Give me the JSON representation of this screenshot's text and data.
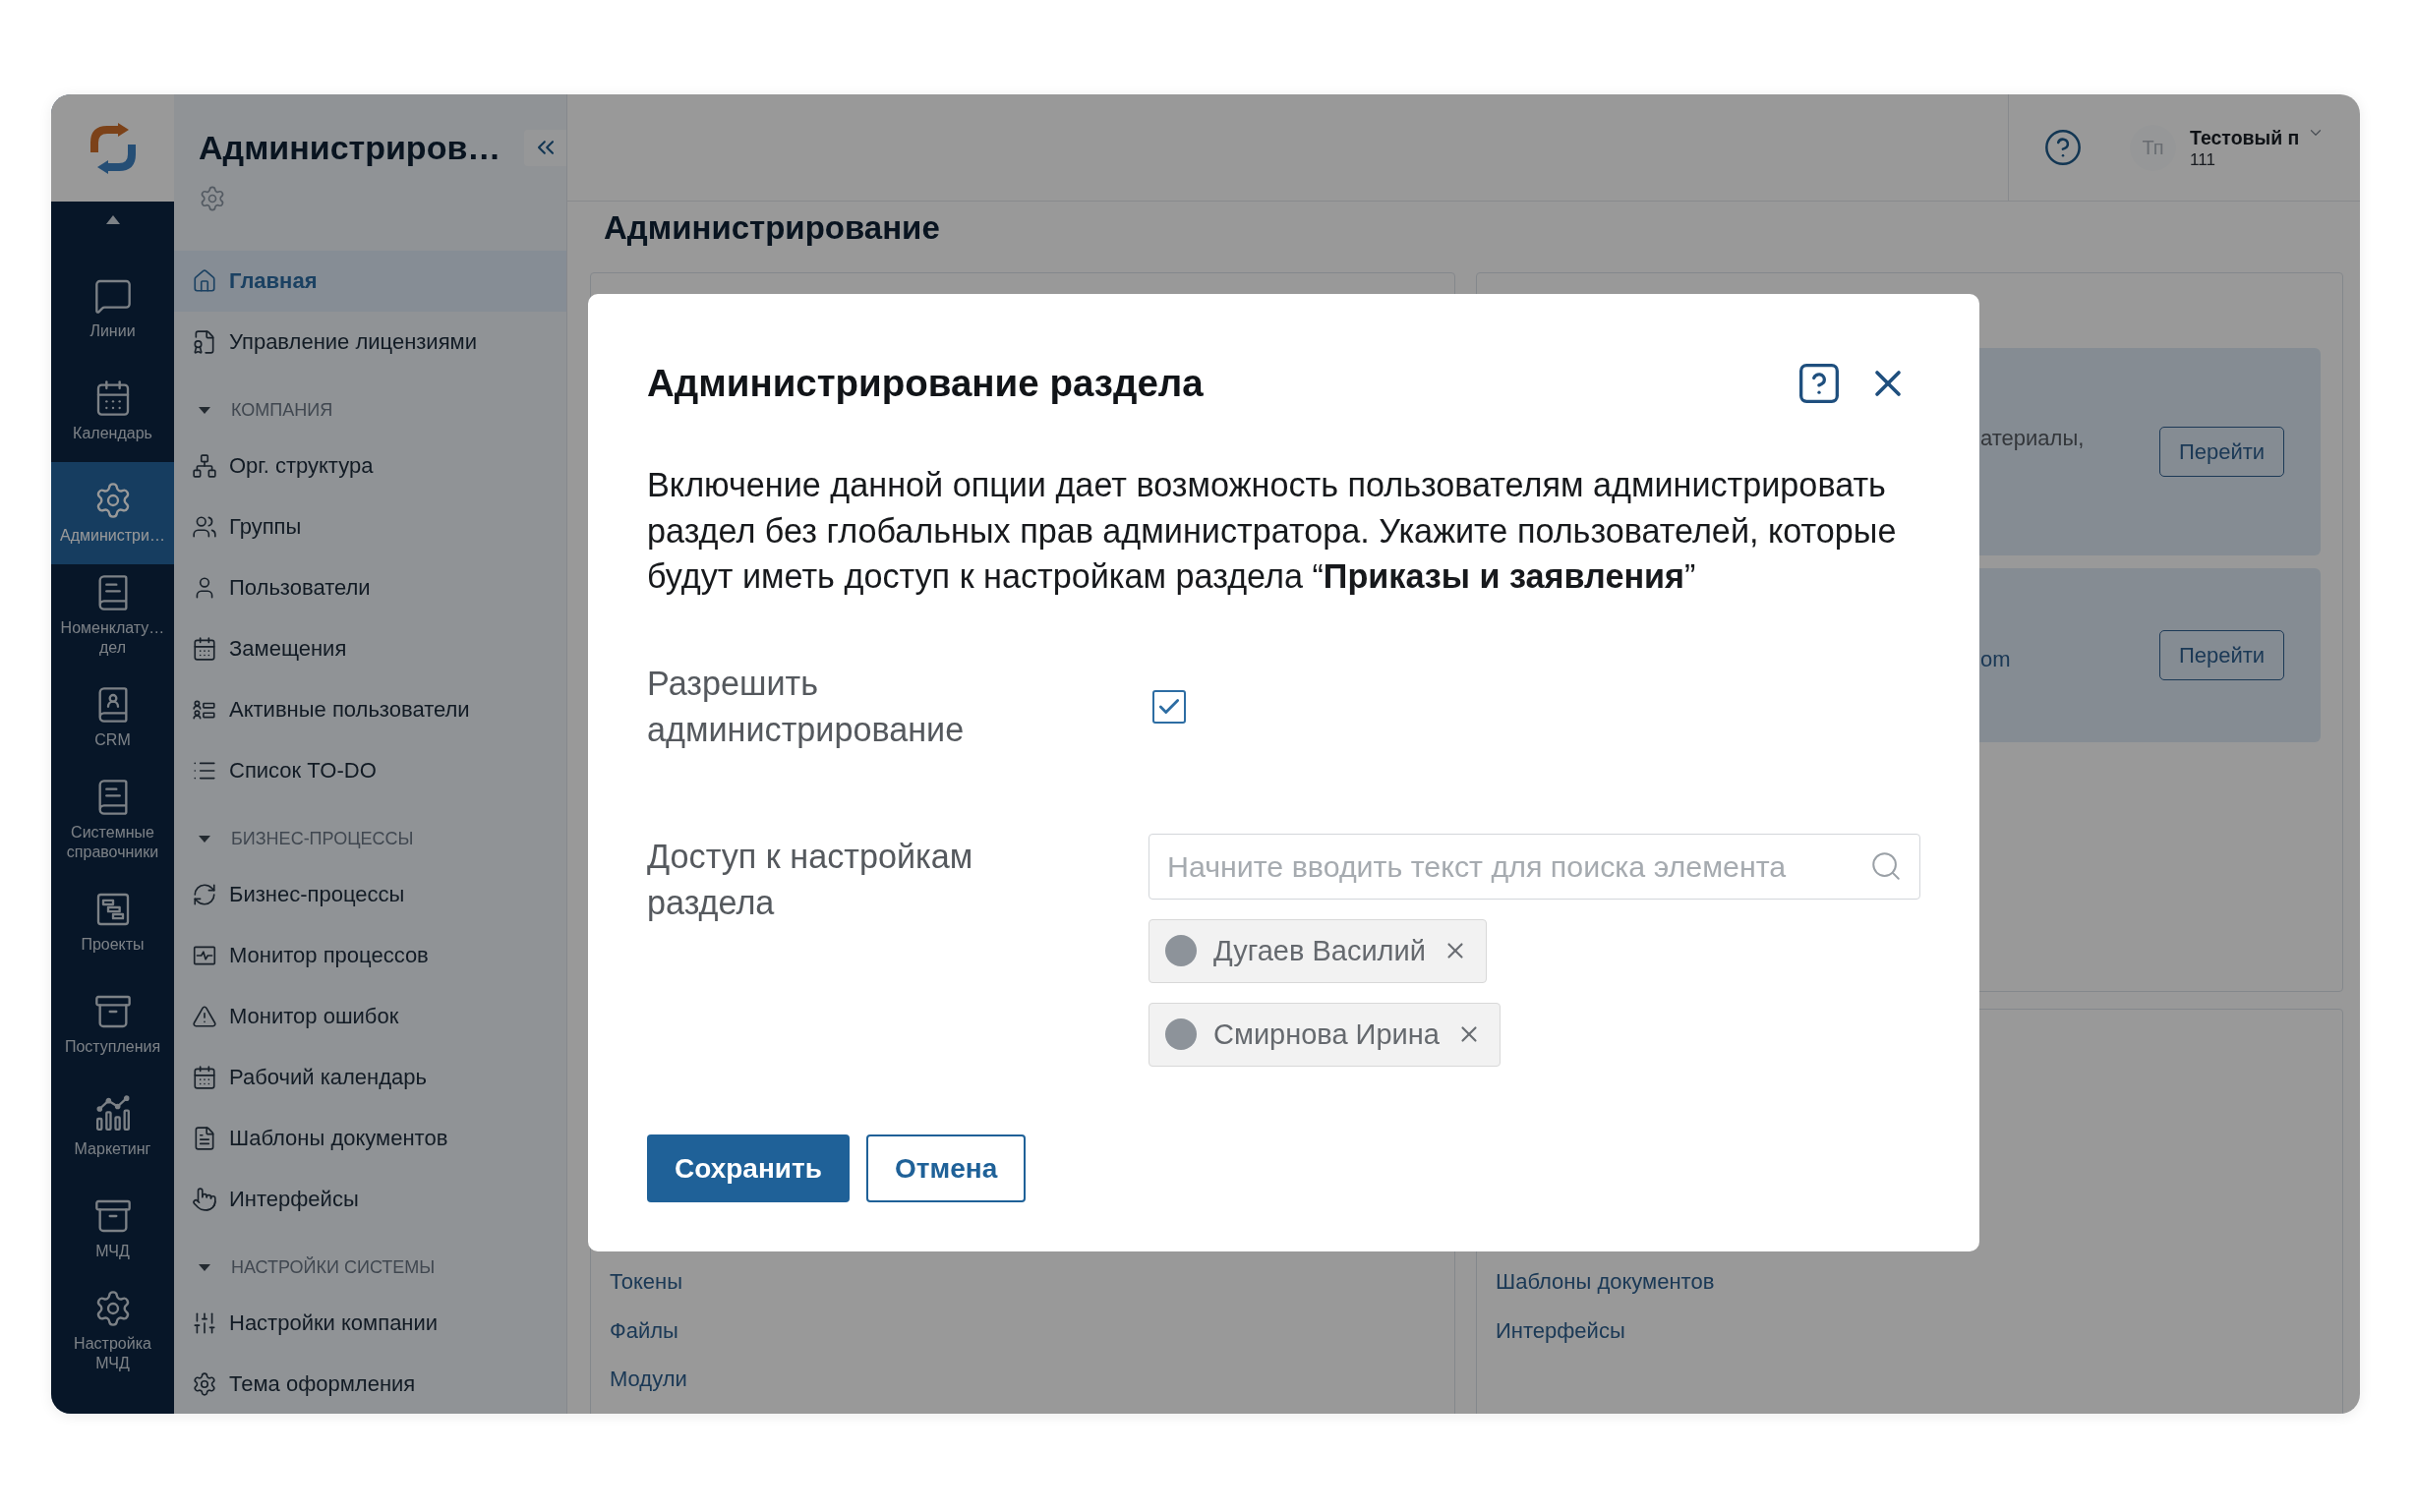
{
  "rail": {
    "items": [
      {
        "label": "Линии",
        "selected": false
      },
      {
        "label": "Календарь",
        "selected": false
      },
      {
        "label": "Администри…",
        "selected": true
      },
      {
        "label": "Номенклату… дел",
        "selected": false
      },
      {
        "label": "CRM",
        "selected": false
      },
      {
        "label": "Системные справочники",
        "selected": false
      },
      {
        "label": "Проекты",
        "selected": false
      },
      {
        "label": "Поступления",
        "selected": false
      },
      {
        "label": "Маркетинг",
        "selected": false
      },
      {
        "label": "МЧД",
        "selected": false
      },
      {
        "label": "Настройка МЧД",
        "selected": false
      }
    ]
  },
  "sidebar": {
    "title": "Администриров…",
    "items": [
      {
        "kind": "link",
        "label": "Главная",
        "selected": true
      },
      {
        "kind": "link",
        "label": "Управление лицензиями",
        "selected": false
      },
      {
        "kind": "section",
        "label": "КОМПАНИЯ",
        "expanded": true,
        "children": [
          {
            "label": "Орг. структура",
            "selected": false
          },
          {
            "label": "Группы",
            "selected": false
          },
          {
            "label": "Пользователи",
            "selected": false
          },
          {
            "label": "Замещения",
            "selected": false
          },
          {
            "label": "Активные пользователи",
            "selected": false
          },
          {
            "label": "Список TO-DO",
            "selected": false
          }
        ]
      },
      {
        "kind": "section",
        "label": "БИЗНЕС-ПРОЦЕССЫ",
        "expanded": true,
        "children": [
          {
            "label": "Бизнес-процессы",
            "selected": false
          },
          {
            "label": "Монитор процессов",
            "selected": false
          },
          {
            "label": "Монитор ошибок",
            "selected": false
          },
          {
            "label": "Рабочий календарь",
            "selected": false
          },
          {
            "label": "Шаблоны документов",
            "selected": false
          },
          {
            "label": "Интерфейсы",
            "selected": false
          }
        ]
      },
      {
        "kind": "section",
        "label": "НАСТРОЙКИ СИСТЕМЫ",
        "expanded": true,
        "children": [
          {
            "label": "Настройки компании",
            "selected": false
          },
          {
            "label": "Тема оформления",
            "selected": false
          }
        ]
      }
    ]
  },
  "topbar": {
    "user": {
      "initials": "Тп",
      "name": "Тестовый п",
      "number": "111"
    }
  },
  "page": {
    "title": "Администрирование",
    "panels": [
      {
        "kind": "text",
        "text": "атериалы,",
        "button": "Перейти"
      },
      {
        "kind": "link",
        "text": "om",
        "button": "Перейти"
      }
    ],
    "links_left": [
      "Токены",
      "Файлы",
      "Модули"
    ],
    "links_right": [
      "Шаблоны документов",
      "Интерфейсы"
    ]
  },
  "dialog": {
    "title": "Администрирование раздела",
    "description": "Включение данной опции дает возможность пользователям администрировать раздел без глобальных прав администратора. Укажите пользователей, которые будут иметь доступ к настройкам раздела “**Приказы и заявления**”",
    "fields": [
      {
        "kind": "checkbox",
        "label": "Разрешить администрирование",
        "checked": true
      },
      {
        "kind": "user_picker",
        "label": "Доступ к настройкам раздела",
        "placeholder": "Начните вводить текст для поиска элемента",
        "selected_users": [
          {
            "name": "Дугаев Василий"
          },
          {
            "name": "Смирнова Ирина"
          }
        ]
      }
    ],
    "buttons": [
      {
        "kind": "primary",
        "label": "Сохранить"
      },
      {
        "kind": "secondary",
        "label": "Отмена"
      }
    ]
  }
}
